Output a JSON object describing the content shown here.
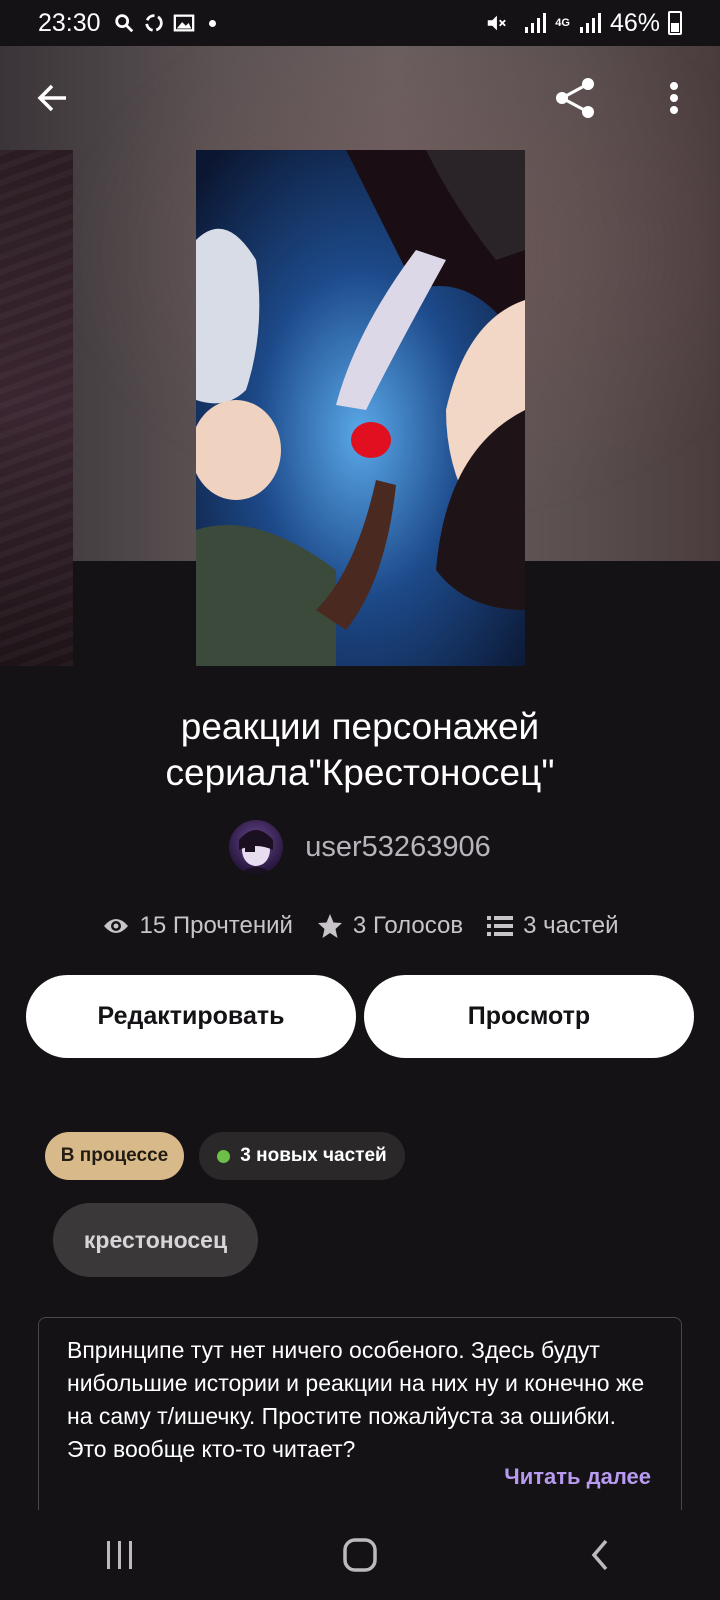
{
  "status_bar": {
    "time": "23:30",
    "network": "4G",
    "battery": "46%",
    "icons": [
      "search-icon",
      "sync-icon",
      "gallery-icon",
      "notification-dot-icon",
      "mute-icon",
      "signal-icon",
      "battery-icon"
    ]
  },
  "toolbar": {
    "back_icon": "arrow-left-icon",
    "share_icon": "share-icon",
    "more_icon": "more-vertical-icon"
  },
  "story": {
    "title": "реакции персонажей сериала\"Крестоносец\"",
    "author": "user53263906",
    "stats": {
      "reads": "15 Прочтений",
      "votes": "3 Голосов",
      "parts": "3 частей"
    }
  },
  "actions": {
    "edit_label": "Редактировать",
    "preview_label": "Просмотр"
  },
  "chips": {
    "status": "В процессе",
    "new_parts": "3 новых частей"
  },
  "tags": [
    "крестоносец"
  ],
  "description": {
    "text": "Впринципе тут нет ничего особеного. Здесь будут нибольшие истории и реакции на них ну и конечно же на саму т/ишечку. Простите пожалйуста за ошибки. Это вообще кто-то читает?",
    "read_more": "Читать далее"
  },
  "colors": {
    "background": "#141215",
    "status_chip": "#d7b98a",
    "new_dot": "#6cc04a",
    "read_more": "#b89af0"
  },
  "nav_bar": {
    "items": [
      "recents-icon",
      "home-icon",
      "back-icon"
    ]
  }
}
